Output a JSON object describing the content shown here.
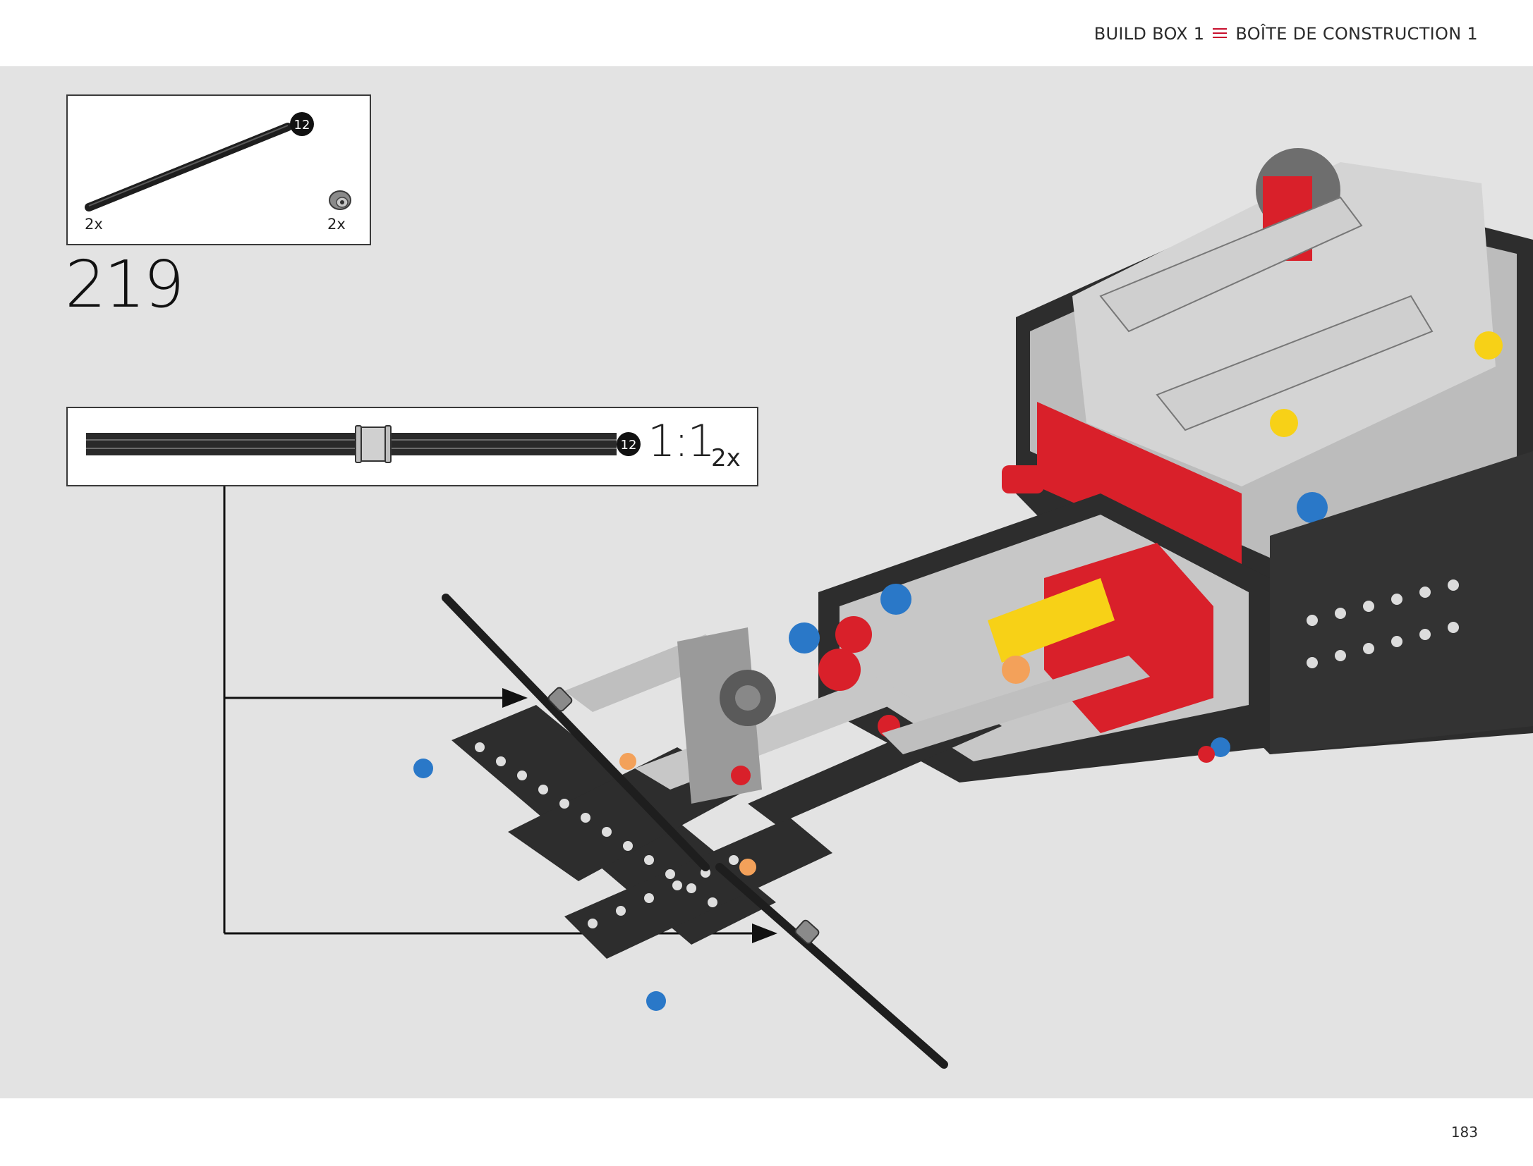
{
  "header": {
    "title_en": "BUILD BOX 1",
    "title_fr": "BOÎTE DE CONSTRUCTION 1",
    "accent_color": "#c8102e"
  },
  "parts_list": {
    "items": [
      {
        "part": "axle",
        "length_label": "12",
        "quantity": "2x"
      },
      {
        "part": "bush",
        "quantity": "2x"
      }
    ]
  },
  "step": {
    "number": "219"
  },
  "scale_callout": {
    "length_label": "12",
    "ratio": "1:1",
    "quantity": "2x"
  },
  "footer": {
    "page_number": "183"
  },
  "icons": [
    "menu-icon",
    "axle-length-badge",
    "callout-arrow"
  ]
}
